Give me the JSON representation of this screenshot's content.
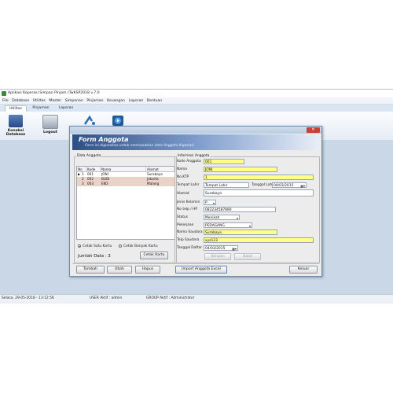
{
  "app": {
    "title": "Aplikasi Koperasi Simpan Pinjam (TwKSP2018 v.7.0",
    "menu": [
      "File",
      "Database",
      "Utilitas",
      "Master",
      "Simpanan",
      "Pinjaman",
      "Keuangan",
      "Laporan",
      "Bantuan"
    ],
    "ribbon_tabs": [
      "Utilitas",
      "Pinjaman",
      "Laporan"
    ],
    "ribbon_buttons": [
      {
        "label": "Koneksi Database",
        "icon": "database-icon"
      },
      {
        "label": "Logout",
        "icon": "logout-icon"
      },
      {
        "label": "",
        "icon": "backup-icon"
      },
      {
        "label": "",
        "icon": "restore-icon"
      }
    ],
    "status": {
      "date": "Selasa, 29-05-2018 - 13:12:56",
      "user": "USER Aktif : admin",
      "group": "GROUP Aktif : Administrator"
    }
  },
  "dialog": {
    "title": "",
    "close_label": "✕",
    "header_title": "Form Anggota",
    "header_subtitle": "Form ini digunakan untuk memasukkan data Anggota Koperasi",
    "left_group_label": "Data Anggota",
    "columns": [
      "No",
      "Kode",
      "Nama",
      "Alamat"
    ],
    "rows": [
      {
        "marker": "▶",
        "no": "1",
        "kode": "001",
        "nama": "JONI",
        "alamat": "Surabaya"
      },
      {
        "marker": "",
        "no": "2",
        "kode": "002",
        "nama": "BUDI",
        "alamat": "Jakarta"
      },
      {
        "marker": "",
        "no": "3",
        "kode": "003",
        "nama": "EKO",
        "alamat": "Malang"
      }
    ],
    "radio_satu": "Cetak Satu Kartu",
    "radio_banyak": "Cetak Banyak Kartu",
    "jumlah_data": "Jumlah Data : 3",
    "cetak_kartu": "Cetak Kartu",
    "right_group_label": "Informasi Anggota",
    "fields": {
      "kode_anggota": {
        "label": "Kode Anggota",
        "value": "001"
      },
      "nama": {
        "label": "Nama",
        "value": "JONI"
      },
      "no_ktp": {
        "label": "No.KTP",
        "value": "1"
      },
      "tempat_lahir": {
        "label": "Tempat Lahir",
        "value": "Tempat Lahir"
      },
      "tanggal_lahir": {
        "label": "Tanggal Lahir",
        "value": "04/03/2015"
      },
      "alamat": {
        "label": "Alamat",
        "value": "Surabaya"
      },
      "jenis_kelamin": {
        "label": "Jenis Kelamin",
        "value": "P"
      },
      "no_telp": {
        "label": "No telp / HP",
        "value": "082234587890"
      },
      "status": {
        "label": "Status",
        "value": "Menikah"
      },
      "pekerjaan": {
        "label": "Pekerjaan",
        "value": "PEDAGANG"
      },
      "nama_saudara": {
        "label": "Nama Saudara",
        "value": "Surabaya"
      },
      "telp_saudara": {
        "label": "Telp Saudara",
        "value": "xyz123"
      },
      "tanggal_daftar": {
        "label": "Tanggal Daftar",
        "value": "04/03/2015"
      }
    },
    "buttons": {
      "simpan": "Simpan",
      "batal": "Batal",
      "tambah": "Tambah",
      "ubah": "Ubah",
      "hapus": "Hapus",
      "import": "Import Anggota Excel",
      "keluar": "Keluar"
    }
  }
}
